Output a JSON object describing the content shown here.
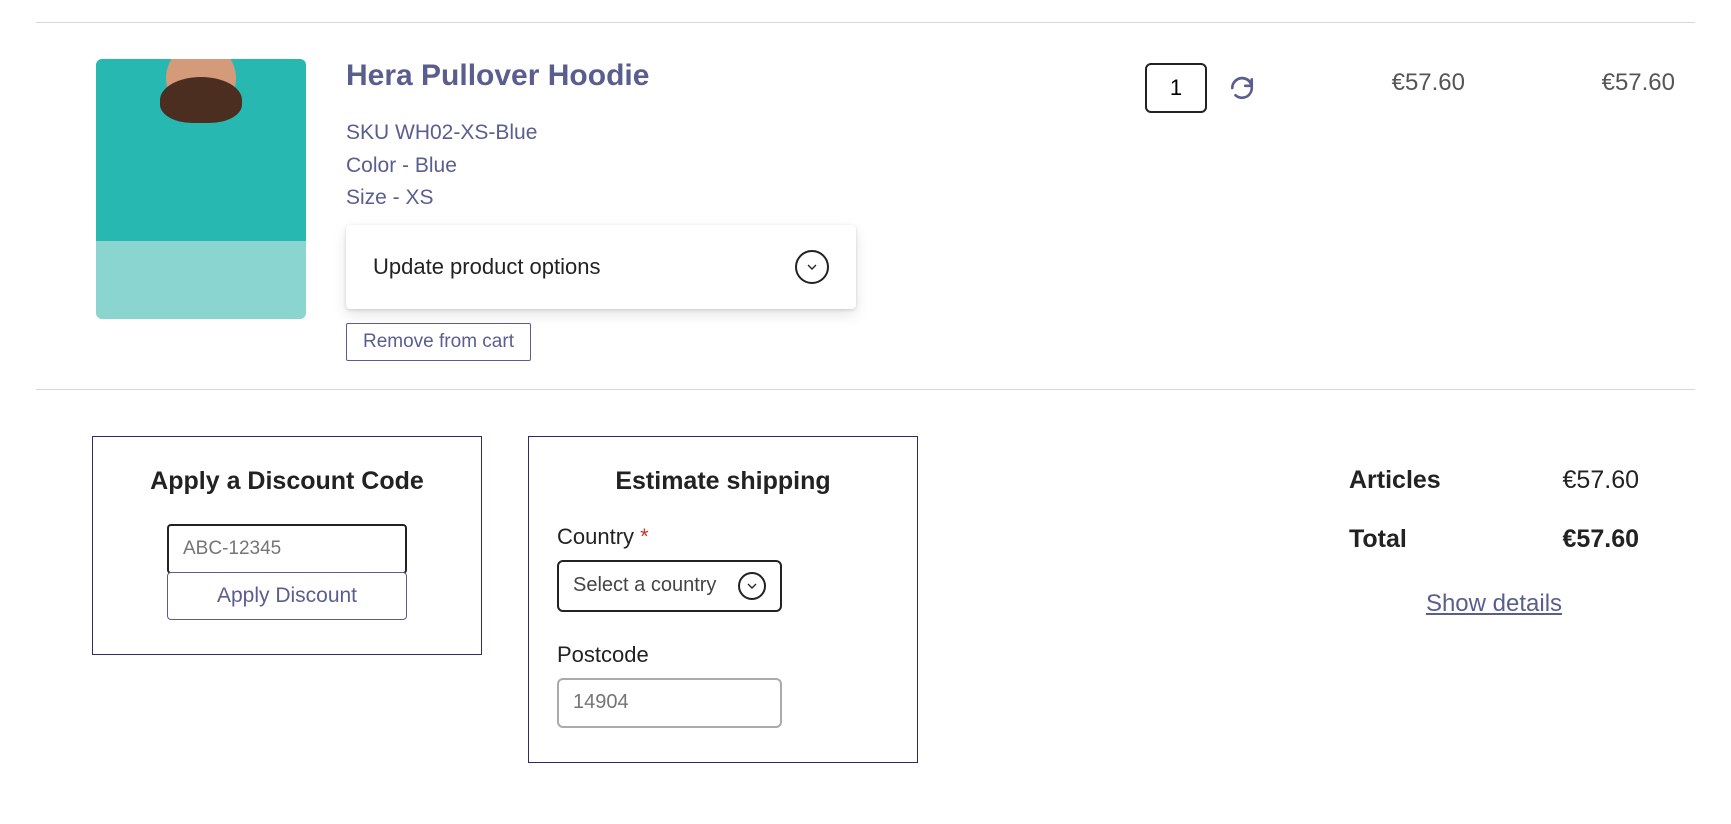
{
  "product": {
    "title": "Hera Pullover Hoodie",
    "sku_line": "SKU WH02-XS-Blue",
    "color_line": "Color - Blue",
    "size_line": "Size - XS",
    "options_toggle": "Update product options",
    "remove_label": "Remove from cart",
    "qty": "1",
    "unit_price": "€57.60",
    "line_total": "€57.60"
  },
  "discount": {
    "heading": "Apply a Discount Code",
    "placeholder": "ABC-12345",
    "apply_label": "Apply Discount"
  },
  "shipping": {
    "heading": "Estimate shipping",
    "country_label": "Country",
    "country_placeholder": "Select a country",
    "postcode_label": "Postcode",
    "postcode_placeholder": "14904"
  },
  "summary": {
    "articles_label": "Articles",
    "articles_value": "€57.60",
    "total_label": "Total",
    "total_value": "€57.60",
    "show_details": "Show details"
  }
}
